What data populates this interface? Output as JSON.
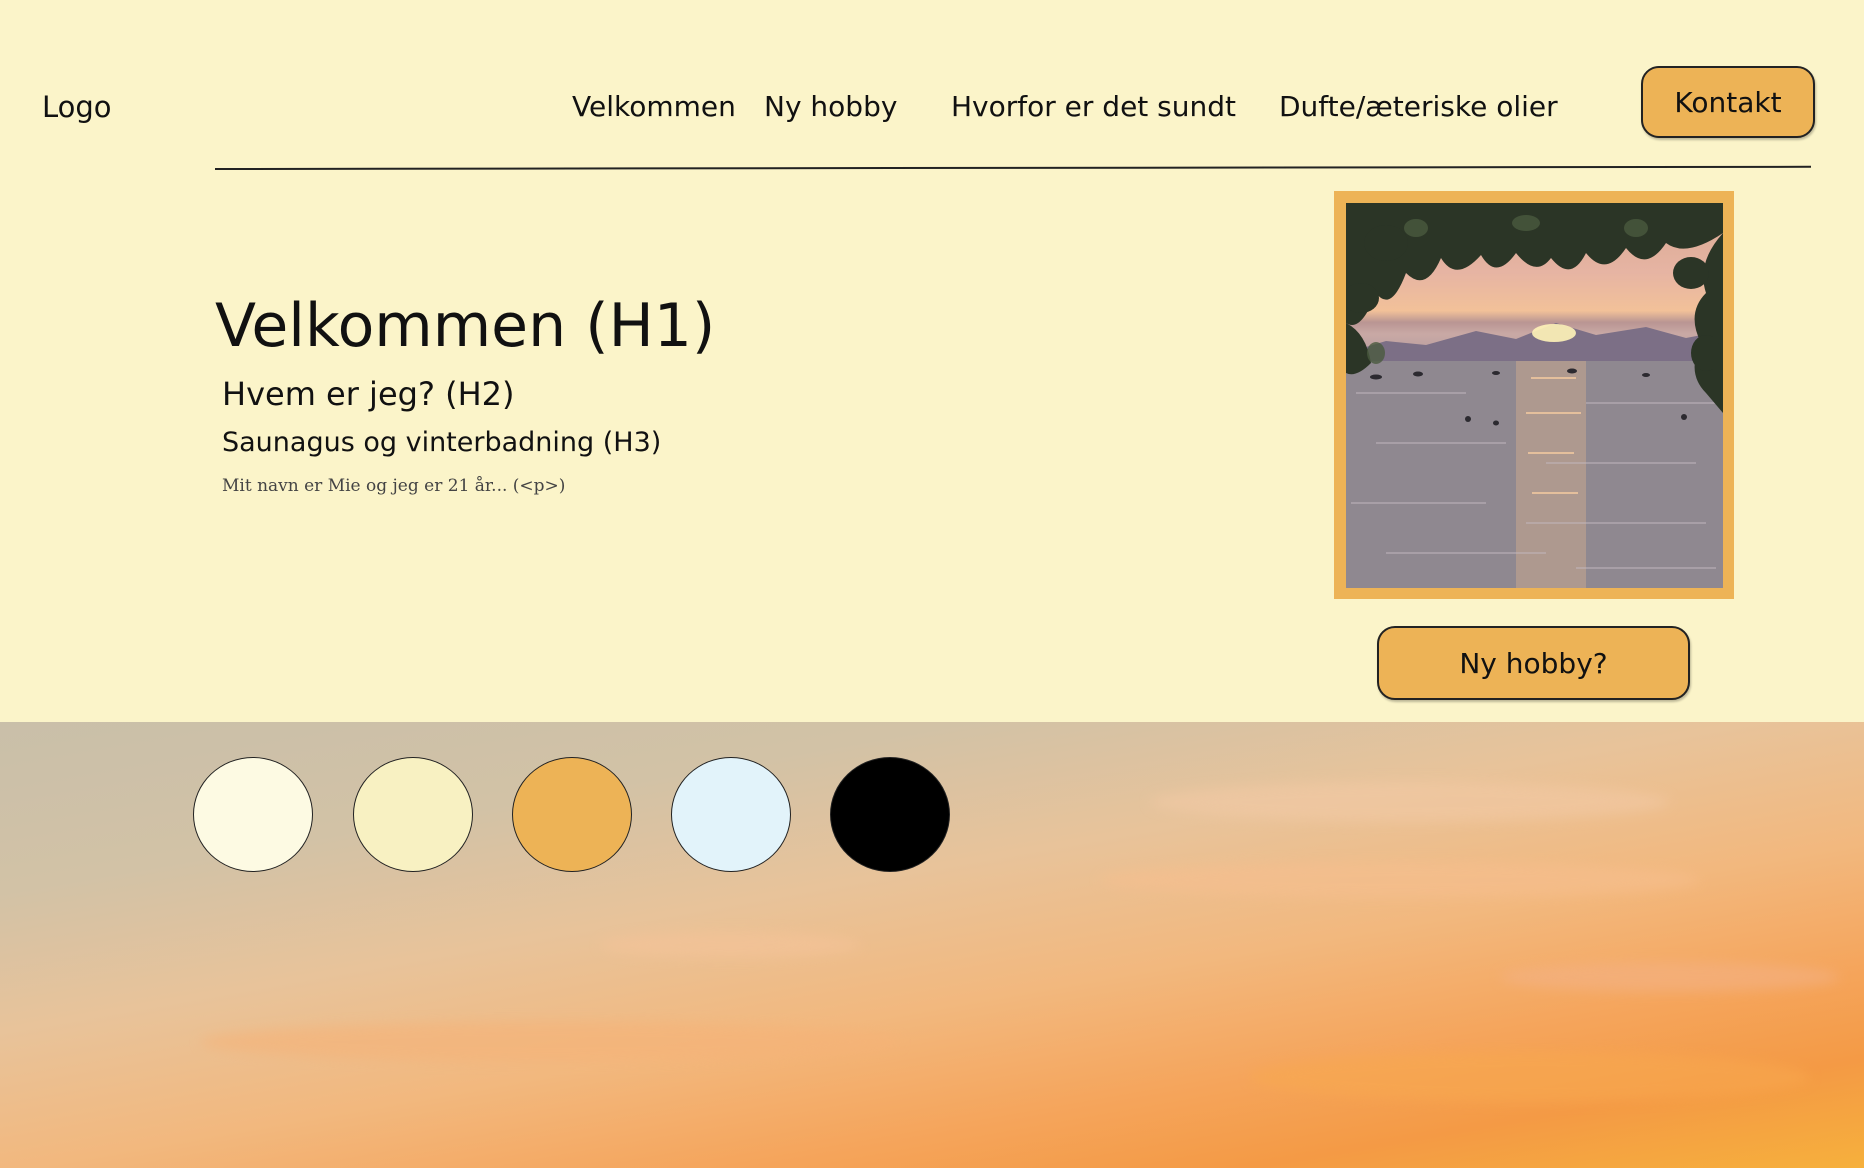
{
  "header": {
    "logo": "Logo",
    "nav": [
      "Velkommen",
      "Ny hobby",
      "Hvorfor er det sundt",
      "Dufte/æteriske olier"
    ],
    "contact_label": "Kontakt"
  },
  "main": {
    "h1": "Velkommen (H1)",
    "h2": "Hvem er jeg? (H2)",
    "h3": "Saunagus og vinterbadning (H3)",
    "paragraph": "Mit navn er Mie og jeg er 21 år... (<p>)",
    "hobby_button_label": "Ny hobby?"
  },
  "colors": {
    "background": "#fbf4c9",
    "accent": "#edb356",
    "palette": [
      "#fdfae3",
      "#f8f1c2",
      "#edb356",
      "#e2f3fa",
      "#000000"
    ]
  },
  "icons": {
    "photo": "sunset-over-lake-image",
    "background": "sunset-sky-image"
  }
}
